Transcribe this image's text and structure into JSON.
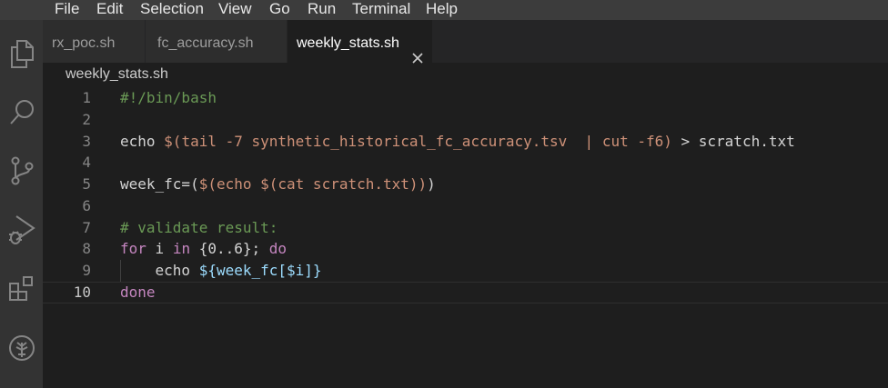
{
  "menu": [
    "File",
    "Edit",
    "Selection",
    "View",
    "Go",
    "Run",
    "Terminal",
    "Help"
  ],
  "activity_bar": [
    {
      "icon": "files-icon"
    },
    {
      "icon": "search-icon"
    },
    {
      "icon": "source-control-icon"
    },
    {
      "icon": "run-debug-icon"
    },
    {
      "icon": "extensions-icon"
    },
    {
      "icon": "tree-logo-icon"
    }
  ],
  "tabs": [
    {
      "label": "rx_poc.sh",
      "active": false
    },
    {
      "label": "fc_accuracy.sh",
      "active": false
    },
    {
      "label": "weekly_stats.sh",
      "active": true
    }
  ],
  "breadcrumb": "weekly_stats.sh",
  "current_line": 10,
  "lines": [
    {
      "n": "1",
      "tokens": [
        {
          "t": "#!/bin/bash",
          "c": "comment"
        }
      ]
    },
    {
      "n": "2",
      "tokens": []
    },
    {
      "n": "3",
      "tokens": [
        {
          "t": "echo ",
          "c": "plain"
        },
        {
          "t": "$(tail -7 synthetic_historical_fc_accuracy.tsv  | cut -f6)",
          "c": "str"
        },
        {
          "t": " > scratch.txt",
          "c": "plain"
        }
      ]
    },
    {
      "n": "4",
      "tokens": []
    },
    {
      "n": "5",
      "tokens": [
        {
          "t": "week_fc=(",
          "c": "plain"
        },
        {
          "t": "$(echo $(cat scratch.txt))",
          "c": "str"
        },
        {
          "t": ")",
          "c": "plain"
        }
      ]
    },
    {
      "n": "6",
      "tokens": []
    },
    {
      "n": "7",
      "tokens": [
        {
          "t": "# validate result:",
          "c": "comment"
        }
      ]
    },
    {
      "n": "8",
      "tokens": [
        {
          "t": "for",
          "c": "kw"
        },
        {
          "t": " i ",
          "c": "plain"
        },
        {
          "t": "in",
          "c": "kw"
        },
        {
          "t": " {0..6}; ",
          "c": "plain"
        },
        {
          "t": "do",
          "c": "kw"
        }
      ]
    },
    {
      "n": "9",
      "tokens": [
        {
          "t": "    echo ",
          "c": "plain"
        },
        {
          "t": "${week_fc[$i]}",
          "c": "var"
        }
      ]
    },
    {
      "n": "10",
      "tokens": [
        {
          "t": "done",
          "c": "kw"
        }
      ]
    }
  ]
}
